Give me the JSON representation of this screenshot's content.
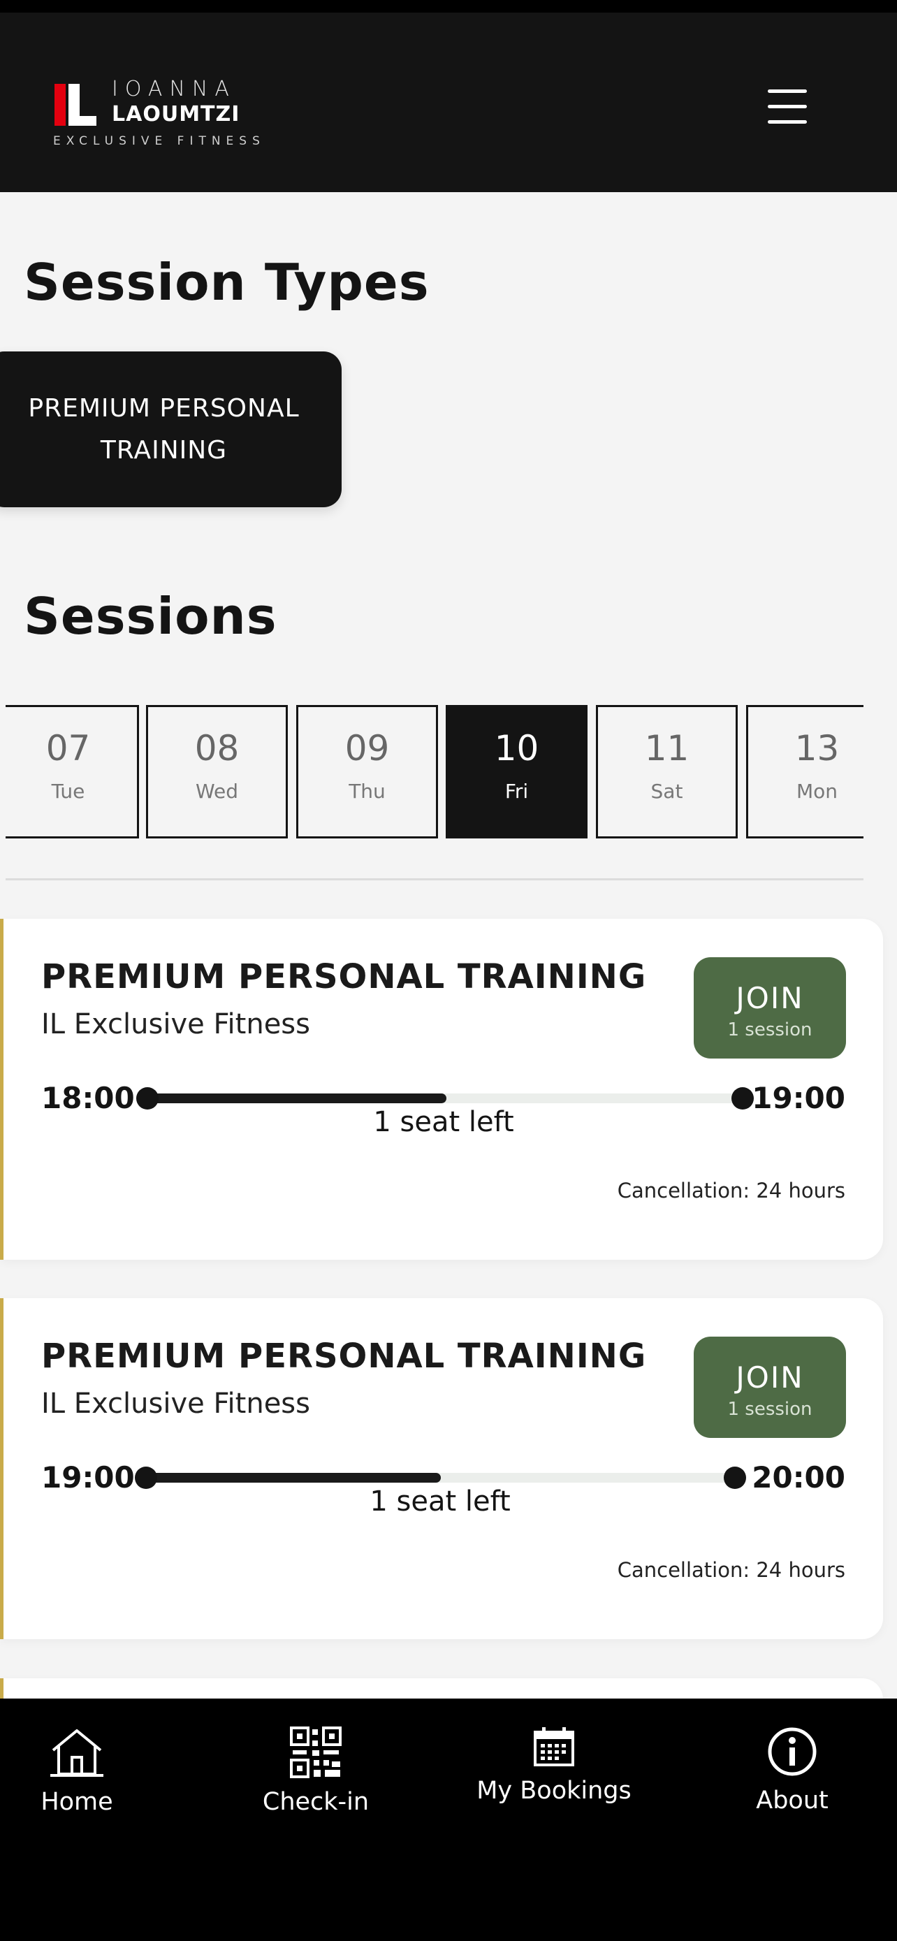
{
  "brand": {
    "name_line1": "IOANNA",
    "name_line2": "LAOUMTZI",
    "tagline": "EXCLUSIVE FITNESS",
    "accent_color": "#e3000f"
  },
  "page": {
    "session_types_title": "Session Types",
    "sessions_title": "Sessions"
  },
  "session_types": [
    {
      "label": "PREMIUM PERSONAL TRAINING",
      "selected": true
    }
  ],
  "dates": [
    {
      "num": "07",
      "dow": "Tue",
      "selected": false
    },
    {
      "num": "08",
      "dow": "Wed",
      "selected": false
    },
    {
      "num": "09",
      "dow": "Thu",
      "selected": false
    },
    {
      "num": "10",
      "dow": "Fri",
      "selected": true
    },
    {
      "num": "11",
      "dow": "Sat",
      "selected": false
    },
    {
      "num": "13",
      "dow": "Mon",
      "selected": false
    }
  ],
  "sessions": [
    {
      "title": "PREMIUM PERSONAL TRAINING",
      "location": "IL Exclusive Fitness",
      "join_label": "JOIN",
      "join_sub": "1 session",
      "start": "18:00",
      "end": "19:00",
      "seats": "1 seat left",
      "occupancy": 0.5,
      "cancellation": "Cancellation: 24 hours"
    },
    {
      "title": "PREMIUM PERSONAL TRAINING",
      "location": "IL Exclusive Fitness",
      "join_label": "JOIN",
      "join_sub": "1 session",
      "start": "19:00",
      "end": "20:00",
      "seats": "1 seat left",
      "occupancy": 0.5,
      "cancellation": "Cancellation: 24 hours"
    }
  ],
  "nav": {
    "home": "Home",
    "checkin": "Check-in",
    "bookings": "My Bookings",
    "about": "About"
  },
  "colors": {
    "join_button": "#4e6b45",
    "card_accent": "#c9ab4a",
    "header": "#141414"
  },
  "icons": {
    "menu": "hamburger-menu-icon",
    "home": "home-icon",
    "checkin": "qr-code-icon",
    "bookings": "calendar-icon",
    "about": "info-icon"
  }
}
